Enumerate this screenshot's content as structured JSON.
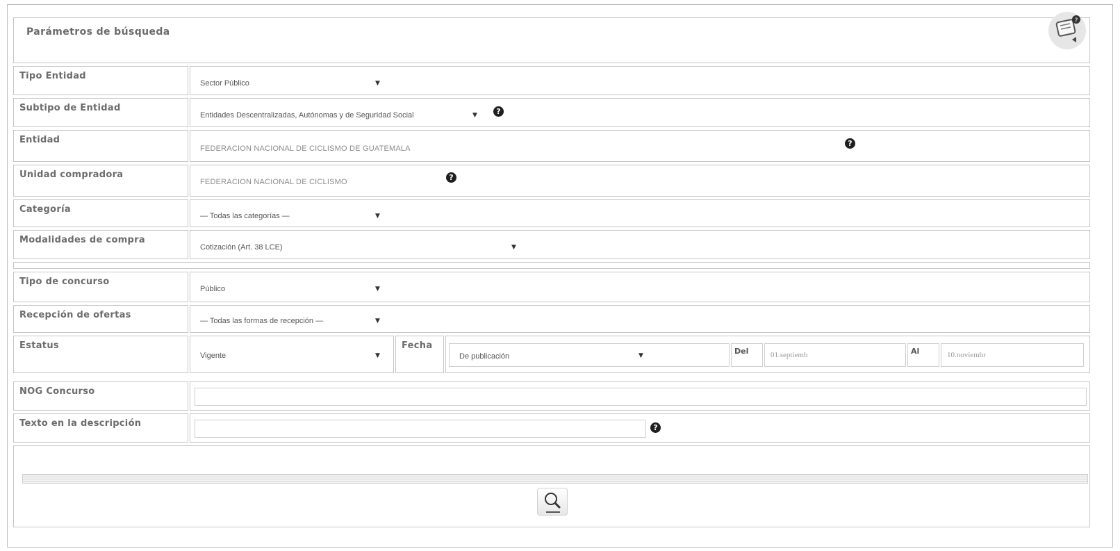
{
  "header": {
    "title": "Parámetros de búsqueda"
  },
  "fields": {
    "tipo_entidad": {
      "label": "Tipo Entidad",
      "value": "Sector Público"
    },
    "subtipo_entidad": {
      "label": "Subtipo de Entidad",
      "value": "Entidades Descentralizadas, Autónomas y de Seguridad Social"
    },
    "entidad": {
      "label": "Entidad",
      "value": "FEDERACION NACIONAL DE CICLISMO DE GUATEMALA"
    },
    "unidad_compradora": {
      "label": "Unidad compradora",
      "value": "FEDERACION NACIONAL DE CICLISMO"
    },
    "categoria": {
      "label": "Categoría",
      "value": "— Todas las categorías —"
    },
    "modalidades": {
      "label": "Modalidades de compra",
      "value": "Cotización (Art. 38 LCE)"
    },
    "tipo_concurso": {
      "label": "Tipo de concurso",
      "value": "Público"
    },
    "recepcion": {
      "label": "Recepción de ofertas",
      "value": "— Todas las formas de recepción —"
    },
    "estatus": {
      "label": "Estatus",
      "value": "Vigente"
    },
    "fecha": {
      "label": "Fecha",
      "value": "De publicación"
    },
    "del": {
      "label": "Del",
      "value": "01.septiemb"
    },
    "al": {
      "label": "Al",
      "value": "10.noviembr"
    },
    "nog": {
      "label": "NOG Concurso",
      "value": ""
    },
    "texto": {
      "label": "Texto en la descripción",
      "value": ""
    }
  },
  "icons": {
    "dropdown": "▼",
    "help": "?",
    "search": "magnifier-icon",
    "corner": "notes-help-icon"
  }
}
